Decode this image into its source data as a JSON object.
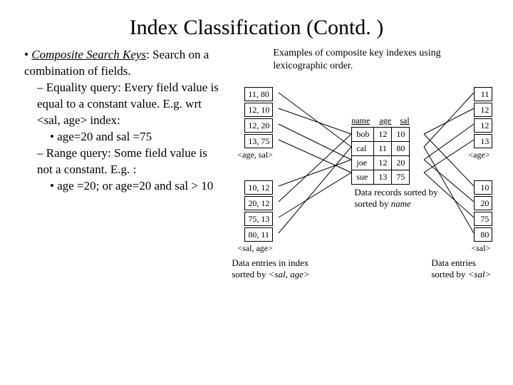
{
  "title": "Index Classification (Contd. )",
  "left": {
    "b1a": "Composite Search Keys",
    "b1b": ": Search on a combination of fields.",
    "d1": "Equality query: Every field value is equal to a constant value. E.g. wrt <sal, age> index:",
    "dot1": "age=20 and sal =75",
    "d2": "Range query: Some field value is not a constant. E.g. :",
    "dot2": "age =20; or age=20 and sal > 10"
  },
  "right": {
    "caption": "Examples of composite key indexes using lexicographic order.",
    "ageSal": [
      "11, 80",
      "12, 10",
      "12, 20",
      "13, 75"
    ],
    "ageSalLabel": "<age, sal>",
    "salAge": [
      "10, 12",
      "20, 12",
      "75, 13",
      "80, 11"
    ],
    "salAgeLabel": "<sal, age>",
    "age": [
      "11",
      "12",
      "12",
      "13"
    ],
    "ageLabel": "<age>",
    "sal": [
      "10",
      "20",
      "75",
      "80"
    ],
    "salLabel": "<sal>",
    "tableHeader": {
      "c1": "name",
      "c2": "age",
      "c3": "sal"
    },
    "rows": [
      {
        "name": "bob",
        "age": "12",
        "sal": "10"
      },
      {
        "name": "cal",
        "age": "11",
        "sal": "80"
      },
      {
        "name": "joe",
        "age": "12",
        "sal": "20"
      },
      {
        "name": "sue",
        "age": "13",
        "sal": "75"
      }
    ],
    "tableCaption": "Data records sorted by ",
    "tableCaptionItalic": "name",
    "footLeft1": "Data entries in index",
    "footLeft2a": "sorted by ",
    "footLeft2b": "<sal, age>",
    "footRight1": "Data entries",
    "footRight2a": "sorted by ",
    "footRight2b": "<sal>"
  }
}
